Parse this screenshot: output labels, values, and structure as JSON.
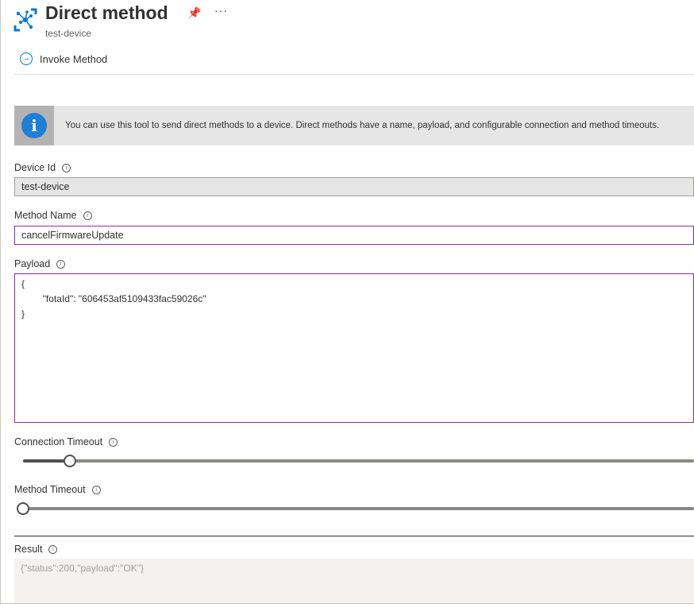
{
  "header": {
    "title": "Direct method",
    "subtitle": "test-device",
    "pin_icon": "pin-icon",
    "more_label": "···"
  },
  "toolbar": {
    "invoke_label": "Invoke Method"
  },
  "info": {
    "text": "You can use this tool to send direct methods to a device. Direct methods have a name, payload, and configurable connection and method timeouts."
  },
  "form": {
    "device_id_label": "Device Id",
    "device_id_value": "test-device",
    "method_name_label": "Method Name",
    "method_name_value": "cancelFirmwareUpdate",
    "payload_label": "Payload",
    "payload_value": "{\n        \"fotaId\": \"606453af5109433fac59026c\"\n}",
    "connection_timeout_label": "Connection Timeout",
    "connection_timeout_fraction": 0.07,
    "method_timeout_label": "Method Timeout",
    "method_timeout_fraction": 0,
    "result_label": "Result",
    "result_value": "{\"status\":200,\"payload\":\"OK\"}"
  },
  "colors": {
    "accent": "#0078d4",
    "focus_border": "#8a2da5"
  }
}
